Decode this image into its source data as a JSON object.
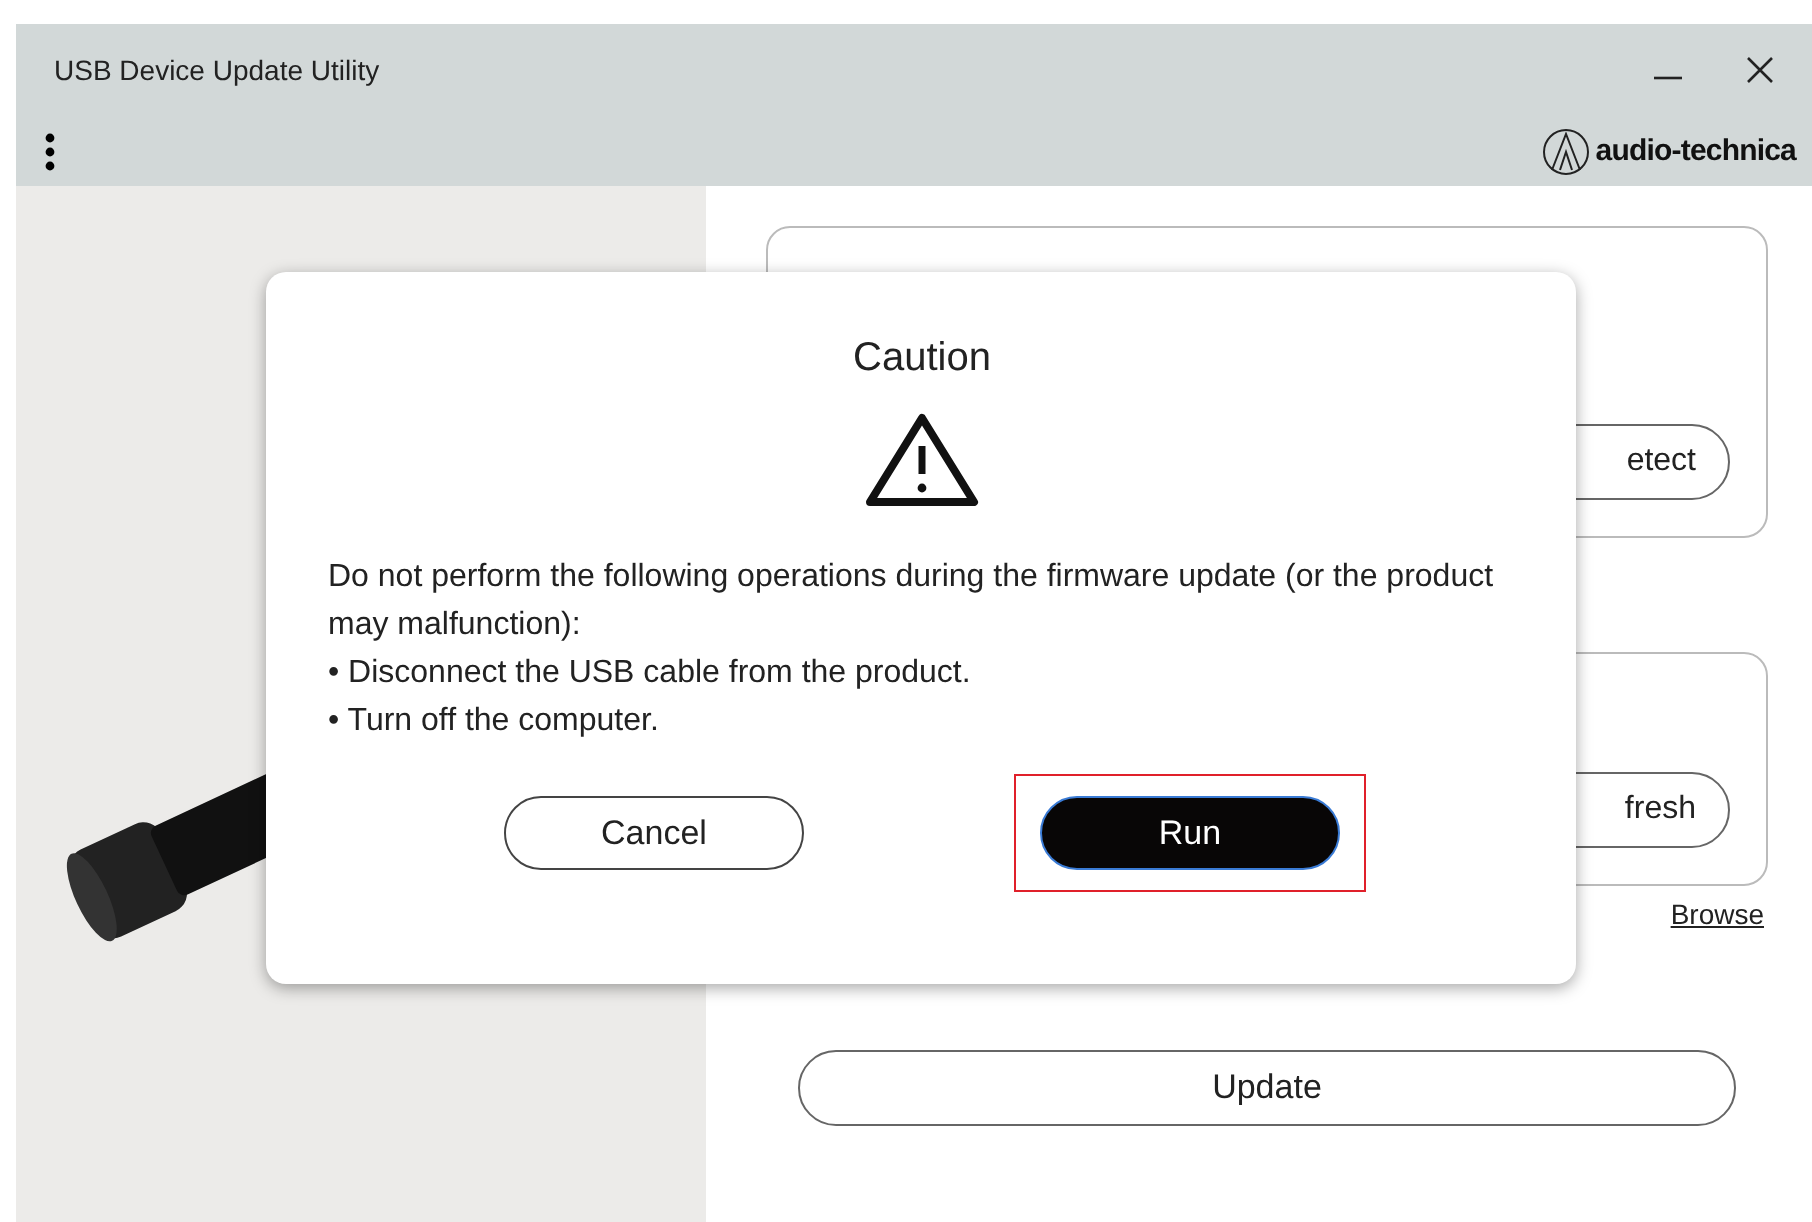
{
  "window": {
    "title": "USB Device Update Utility",
    "brand": "audio-technica"
  },
  "panel": {
    "detect_button": "etect",
    "refresh_button": "fresh",
    "browse_link": "Browse",
    "update_button": "Update"
  },
  "dialog": {
    "title": "Caution",
    "message": "Do not perform the following operations during the firmware update (or the product may malfunction):",
    "bullets": [
      "• Disconnect the USB cable from the product.",
      "• Turn off the computer."
    ],
    "buttons": [
      {
        "label": "Cancel",
        "kind": "secondary",
        "highlighted": false
      },
      {
        "label": "Run",
        "kind": "primary",
        "highlighted": true
      }
    ]
  }
}
